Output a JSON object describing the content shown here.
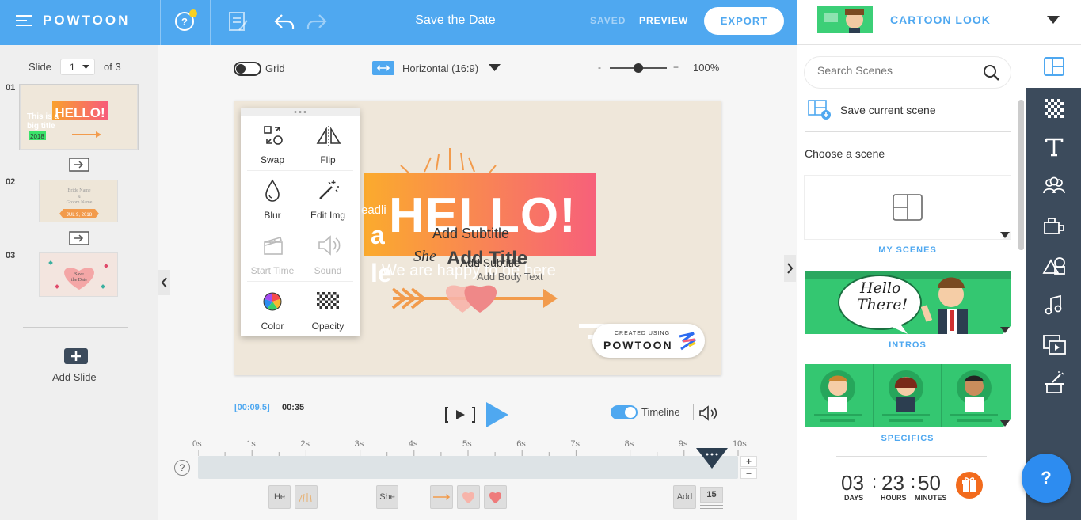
{
  "app": {
    "brand": "POWTOON",
    "title": "Save the Date",
    "saved": "SAVED",
    "preview": "PREVIEW",
    "export": "EXPORT"
  },
  "style": {
    "name": "CARTOON LOOK"
  },
  "slides": {
    "label": "Slide",
    "current": "1",
    "of": "of 3",
    "items": [
      "01",
      "02",
      "03"
    ],
    "add": "Add Slide"
  },
  "canvas_bar": {
    "grid": "Grid",
    "orientation": "Horizontal (16:9)",
    "zoom": "100%",
    "zoom_minus": "-",
    "zoom_plus": "+"
  },
  "tools": [
    {
      "label": "Swap",
      "enabled": true
    },
    {
      "label": "Flip",
      "enabled": true
    },
    {
      "label": "Blur",
      "enabled": true
    },
    {
      "label": "Edit Img",
      "enabled": true
    },
    {
      "label": "Start Time",
      "enabled": false
    },
    {
      "label": "Sound",
      "enabled": false
    },
    {
      "label": "Color",
      "enabled": true
    },
    {
      "label": "Opacity",
      "enabled": true
    }
  ],
  "canvas": {
    "hello": "HELLO!",
    "subtitle": "Add Subtitle",
    "subtitle2": "Add Subtitle",
    "title_frag": "Add Title",
    "body": "Add Body Text",
    "happy": "We are happy to be here",
    "headline_frag": "eadli",
    "a_frag": "a",
    "le_frag": "le",
    "she_frag": "She",
    "created_using": "CREATED USING",
    "powtoon": "POWTOON"
  },
  "player": {
    "current": "[00:09.5]",
    "total": "00:35",
    "timeline": "Timeline"
  },
  "timeline": {
    "ticks": [
      "0s",
      "1s",
      "2s",
      "3s",
      "4s",
      "5s",
      "6s",
      "7s",
      "8s",
      "9s",
      "10s"
    ],
    "chips": [
      "He",
      "She",
      "Add"
    ],
    "count": "15",
    "plus": "+",
    "minus": "−",
    "help": "?"
  },
  "scenes": {
    "search_placeholder": "Search Scenes",
    "save": "Save current scene",
    "choose": "Choose a scene",
    "categories": [
      "MY SCENES",
      "INTROS",
      "SPECIFICS"
    ],
    "intro_bubble_line1": "Hello",
    "intro_bubble_line2": "There!"
  },
  "countdown": {
    "days": "03",
    "hours": "23",
    "minutes": "50",
    "days_lbl": "DAYS",
    "hours_lbl": "HOURS",
    "minutes_lbl": "MINUTES",
    "colon": ":"
  },
  "help": "?",
  "colors": {
    "primary": "#4fa8f0",
    "sidebar": "#3c4b5c",
    "scene_green": "#2fc46e",
    "gift": "#f26b1d"
  }
}
